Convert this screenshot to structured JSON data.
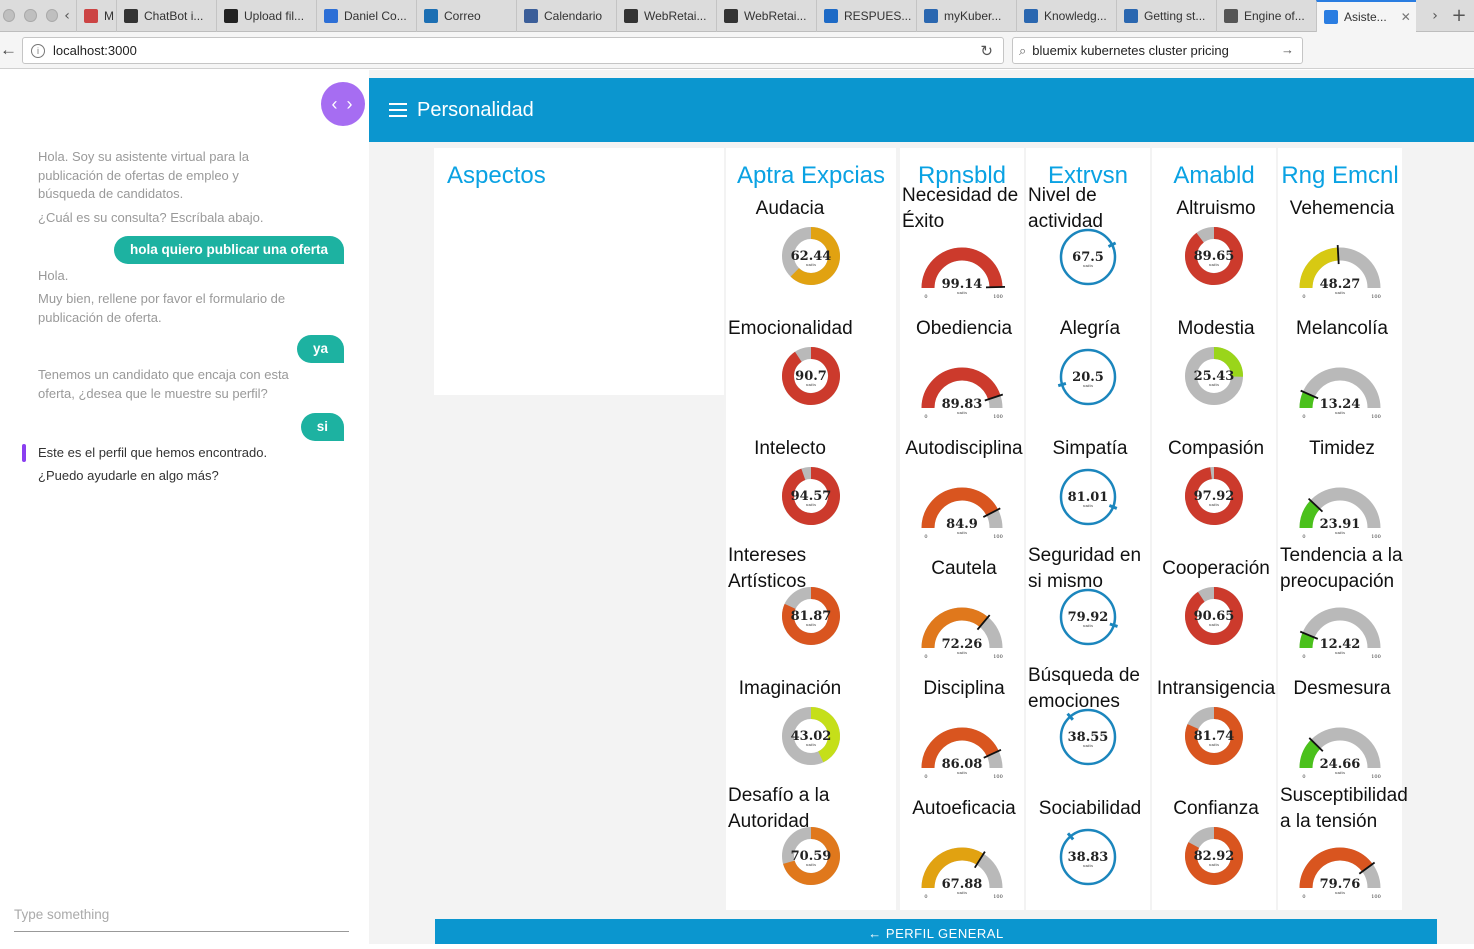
{
  "browser": {
    "tabs": [
      {
        "label": "M",
        "icon": "gmail-icon",
        "color": "#c44"
      },
      {
        "label": "ChatBot i...",
        "icon": "cursor-icon",
        "color": "#333"
      },
      {
        "label": "Upload fil...",
        "icon": "github-icon",
        "color": "#222"
      },
      {
        "label": "Daniel Co...",
        "icon": "people-icon",
        "color": "#2d6fd6"
      },
      {
        "label": "Correo",
        "icon": "v-icon",
        "color": "#1c6fb3"
      },
      {
        "label": "Calendario",
        "icon": "calendar-icon",
        "color": "#3b5e99"
      },
      {
        "label": "WebRetai...",
        "icon": "w3-icon",
        "color": "#333"
      },
      {
        "label": "WebRetai...",
        "icon": "w3-icon",
        "color": "#333"
      },
      {
        "label": "RESPUES...",
        "icon": "box-icon",
        "color": "#1d6ac6"
      },
      {
        "label": "myKuber...",
        "icon": "bluemix-icon",
        "color": "#2a67b0"
      },
      {
        "label": "Knowledg...",
        "icon": "bluemix-icon",
        "color": "#2a67b0"
      },
      {
        "label": "Getting st...",
        "icon": "bluemix-icon",
        "color": "#2a67b0"
      },
      {
        "label": "Engine of...",
        "icon": "globe-icon",
        "color": "#555"
      },
      {
        "label": "Asiste...",
        "icon": "globe-icon",
        "color": "#2a7de1"
      }
    ],
    "url": "localhost:3000",
    "search_value": "bluemix kubernetes cluster pricing"
  },
  "chat": {
    "messages": [
      {
        "role": "bot",
        "lines": [
          "Hola. Soy su asistente virtual para la",
          "publicación de ofertas de empleo y",
          "búsqueda de candidatos."
        ]
      },
      {
        "role": "bot",
        "lines": [
          "¿Cuál es su consulta? Escríbala abajo."
        ]
      },
      {
        "role": "user",
        "text": "hola quiero publicar una oferta"
      },
      {
        "role": "bot",
        "lines": [
          "Hola."
        ]
      },
      {
        "role": "bot",
        "lines": [
          "Muy bien, rellene por favor el formulario de",
          "publicación de oferta."
        ]
      },
      {
        "role": "user",
        "text": "ya"
      },
      {
        "role": "bot",
        "lines": [
          "Tenemos un candidato que encaja con esta",
          "oferta, ¿desea que le muestre su perfil?"
        ]
      },
      {
        "role": "user",
        "text": "si"
      },
      {
        "role": "bot",
        "lines": [
          "Este es el perfil que hemos encontrado."
        ]
      },
      {
        "role": "bot",
        "lines": [
          "¿Puedo ayudarle en algo más?"
        ]
      }
    ],
    "input_placeholder": "Type something"
  },
  "header": {
    "title": "Personalidad"
  },
  "aspects_title": "Aspectos",
  "gauge_unit": "units",
  "gauge_min": "0",
  "gauge_max": "100",
  "colors": {
    "accent": "#0b96cf",
    "title_blue": "#0aa2e3",
    "chat_user": "#1db2a1",
    "toggle": "#a66df2"
  },
  "columns": [
    {
      "title": "Aptra Expcias",
      "style": "donut",
      "items": [
        {
          "label": "Audacia",
          "value": 62.44
        },
        {
          "label": "Emocionalidad",
          "value": 90.7
        },
        {
          "label": "Intelecto",
          "value": 94.57
        },
        {
          "label": "Intereses Artísticos",
          "value": 81.87
        },
        {
          "label": "Imaginación",
          "value": 43.02
        },
        {
          "label": "Desafío a la Autoridad",
          "value": 70.59
        }
      ]
    },
    {
      "title": "Rpnsbld",
      "style": "arc",
      "items": [
        {
          "label": "Necesidad de Éxito",
          "value": 99.14
        },
        {
          "label": "Obediencia",
          "value": 89.83
        },
        {
          "label": "Autodisciplina",
          "value": 84.9
        },
        {
          "label": "Cautela",
          "value": 72.26
        },
        {
          "label": "Disciplina",
          "value": 86.08
        },
        {
          "label": "Autoeficacia",
          "value": 67.88
        }
      ]
    },
    {
      "title": "Extrvsn",
      "style": "ring",
      "items": [
        {
          "label": "Nivel de actividad",
          "value": 67.5
        },
        {
          "label": "Alegría",
          "value": 20.5
        },
        {
          "label": "Simpatía",
          "value": 81.01
        },
        {
          "label": "Seguridad en si mismo",
          "value": 79.92
        },
        {
          "label": "Búsqueda de emociones",
          "value": 38.55
        },
        {
          "label": "Sociabilidad",
          "value": 38.83
        }
      ]
    },
    {
      "title": "Amabld",
      "style": "donut",
      "items": [
        {
          "label": "Altruismo",
          "value": 89.65
        },
        {
          "label": "Modestia",
          "value": 25.43
        },
        {
          "label": "Compasión",
          "value": 97.92
        },
        {
          "label": "Cooperación",
          "value": 90.65
        },
        {
          "label": "Intransigencia",
          "value": 81.74
        },
        {
          "label": "Confianza",
          "value": 82.92
        }
      ]
    },
    {
      "title": "Rng Emcnl",
      "style": "arc",
      "items": [
        {
          "label": "Vehemencia",
          "value": 48.27
        },
        {
          "label": "Melancolía",
          "value": 13.24
        },
        {
          "label": "Timidez",
          "value": 23.91
        },
        {
          "label": "Tendencia a la preocupación",
          "value": 12.42
        },
        {
          "label": "Desmesura",
          "value": 24.66
        },
        {
          "label": "Susceptibilidad a la tensión",
          "value": 79.76
        }
      ]
    }
  ],
  "bottom_button": "← PERFIL GENERAL"
}
